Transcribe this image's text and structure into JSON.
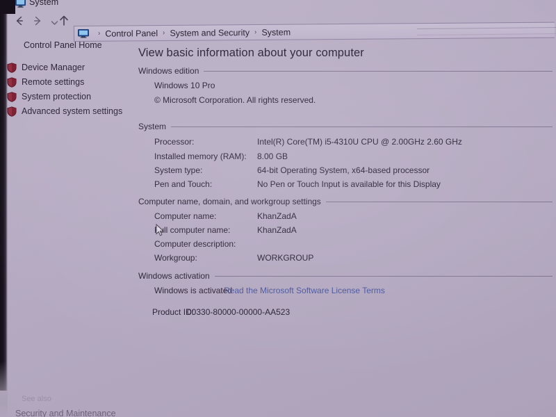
{
  "window": {
    "title": "System",
    "title_icon": "monitor-icon"
  },
  "nav": {
    "back_icon": "arrow-left-icon",
    "forward_icon": "arrow-right-icon",
    "recent_icon": "chevron-down-icon",
    "up_icon": "arrow-up-icon",
    "address_icon": "monitor-icon",
    "breadcrumbs": [
      {
        "label": "Control Panel"
      },
      {
        "label": "System and Security"
      },
      {
        "label": "System"
      }
    ],
    "separator": "›"
  },
  "sidebar": {
    "home_label": "Control Panel Home",
    "items": [
      {
        "label": "Device Manager",
        "icon": "shield-icon"
      },
      {
        "label": "Remote settings",
        "icon": "shield-icon"
      },
      {
        "label": "System protection",
        "icon": "shield-icon"
      },
      {
        "label": "Advanced system settings",
        "icon": "shield-icon"
      }
    ],
    "see_also_label": "See also",
    "see_also_items": [
      {
        "label": "Security and Maintenance"
      }
    ]
  },
  "main": {
    "page_title": "View basic information about your computer",
    "sections": [
      {
        "heading": "Windows edition",
        "lines": [
          "Windows 10 Pro",
          "© Microsoft Corporation. All rights reserved."
        ]
      },
      {
        "heading": "System",
        "rows": [
          {
            "label": "Processor:",
            "value": "Intel(R) Core(TM) i5-4310U CPU @ 2.00GHz   2.60 GHz"
          },
          {
            "label": "Installed memory (RAM):",
            "value": "8.00 GB"
          },
          {
            "label": "System type:",
            "value": "64-bit Operating System, x64-based processor"
          },
          {
            "label": "Pen and Touch:",
            "value": "No Pen or Touch Input is available for this Display"
          }
        ]
      },
      {
        "heading": "Computer name, domain, and workgroup settings",
        "rows": [
          {
            "label": "Computer name:",
            "value": "KhanZadA"
          },
          {
            "label": "Full computer name:",
            "value": "KhanZadA"
          },
          {
            "label": "Computer description:",
            "value": ""
          },
          {
            "label": "Workgroup:",
            "value": "WORKGROUP"
          }
        ]
      },
      {
        "heading": "Windows activation",
        "status": "Windows is activated",
        "link": "Read the Microsoft Software License Terms",
        "product_id_label": "Product ID:",
        "product_id_value": "00330-80000-00000-AA523"
      }
    ]
  },
  "colors": {
    "background": "#b5aac2",
    "text": "#2b2236",
    "link": "#49549c",
    "shield": "#7c1f33",
    "rule": "#6f6480"
  }
}
